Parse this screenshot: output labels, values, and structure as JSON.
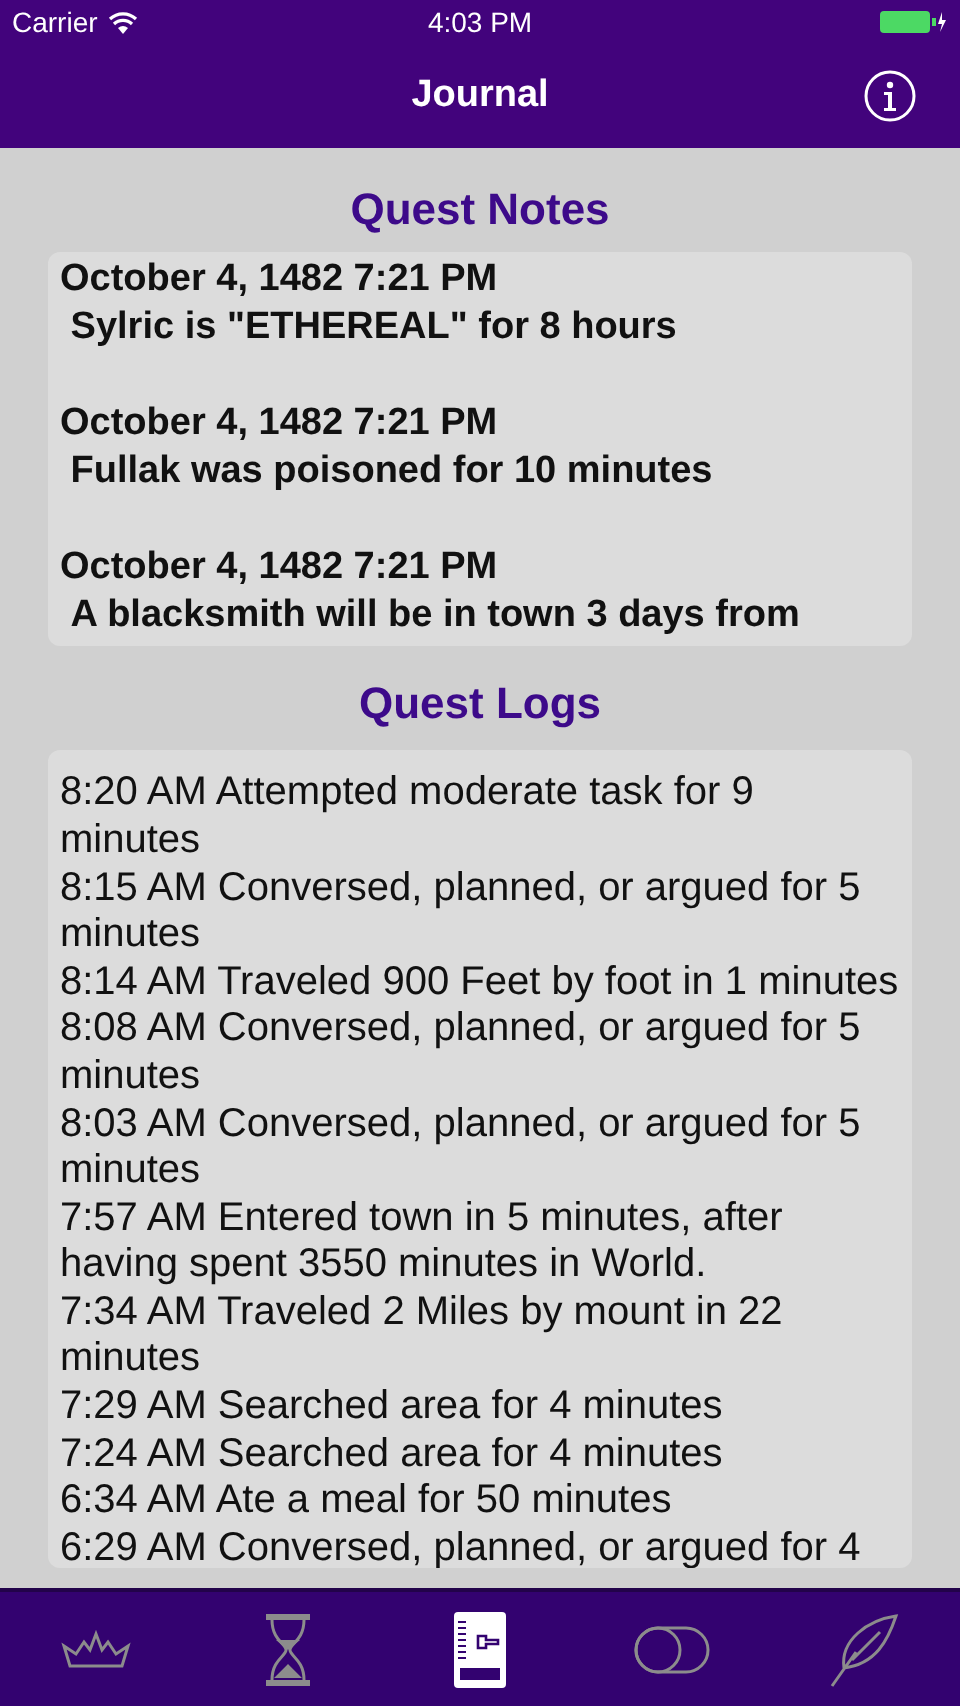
{
  "status_bar": {
    "carrier": "Carrier",
    "time": "4:03 PM"
  },
  "nav_bar": {
    "title": "Journal"
  },
  "quest_notes": {
    "title": "Quest Notes",
    "entries": [
      {
        "date": "October 4, 1482 7:21 PM",
        "text": "Sylric is \"ETHEREAL\" for 8 hours"
      },
      {
        "date": "October 4, 1482 7:21 PM",
        "text": "Fullak was poisoned for 10 minutes"
      },
      {
        "date": "October 4, 1482 7:21 PM",
        "text": "A blacksmith will be in town 3 days from"
      }
    ]
  },
  "quest_logs": {
    "title": "Quest Logs",
    "entries": [
      "8:20 AM Attempted moderate task for 9 minutes",
      "8:15 AM Conversed, planned, or argued for 5 minutes",
      "8:14 AM Traveled 900 Feet by foot in 1 minutes",
      "8:08 AM Conversed, planned, or argued for 5 minutes",
      "8:03 AM Conversed, planned, or argued for 5 minutes",
      "7:57 AM Entered town in 5 minutes, after having spent 3550 minutes in World.",
      "7:34 AM Traveled 2 Miles by mount in 22 minutes",
      "7:29 AM Searched area for 4 minutes",
      "7:24 AM Searched area for 4 minutes",
      "6:34 AM Ate a meal for 50 minutes",
      "6:29 AM Conversed, planned, or argued for 4"
    ]
  },
  "tab_bar": [
    {
      "kind": "crown",
      "selected": false
    },
    {
      "kind": "hourglass",
      "selected": false
    },
    {
      "kind": "journal",
      "selected": true
    },
    {
      "kind": "toggle",
      "selected": false
    },
    {
      "kind": "quill",
      "selected": false
    }
  ]
}
